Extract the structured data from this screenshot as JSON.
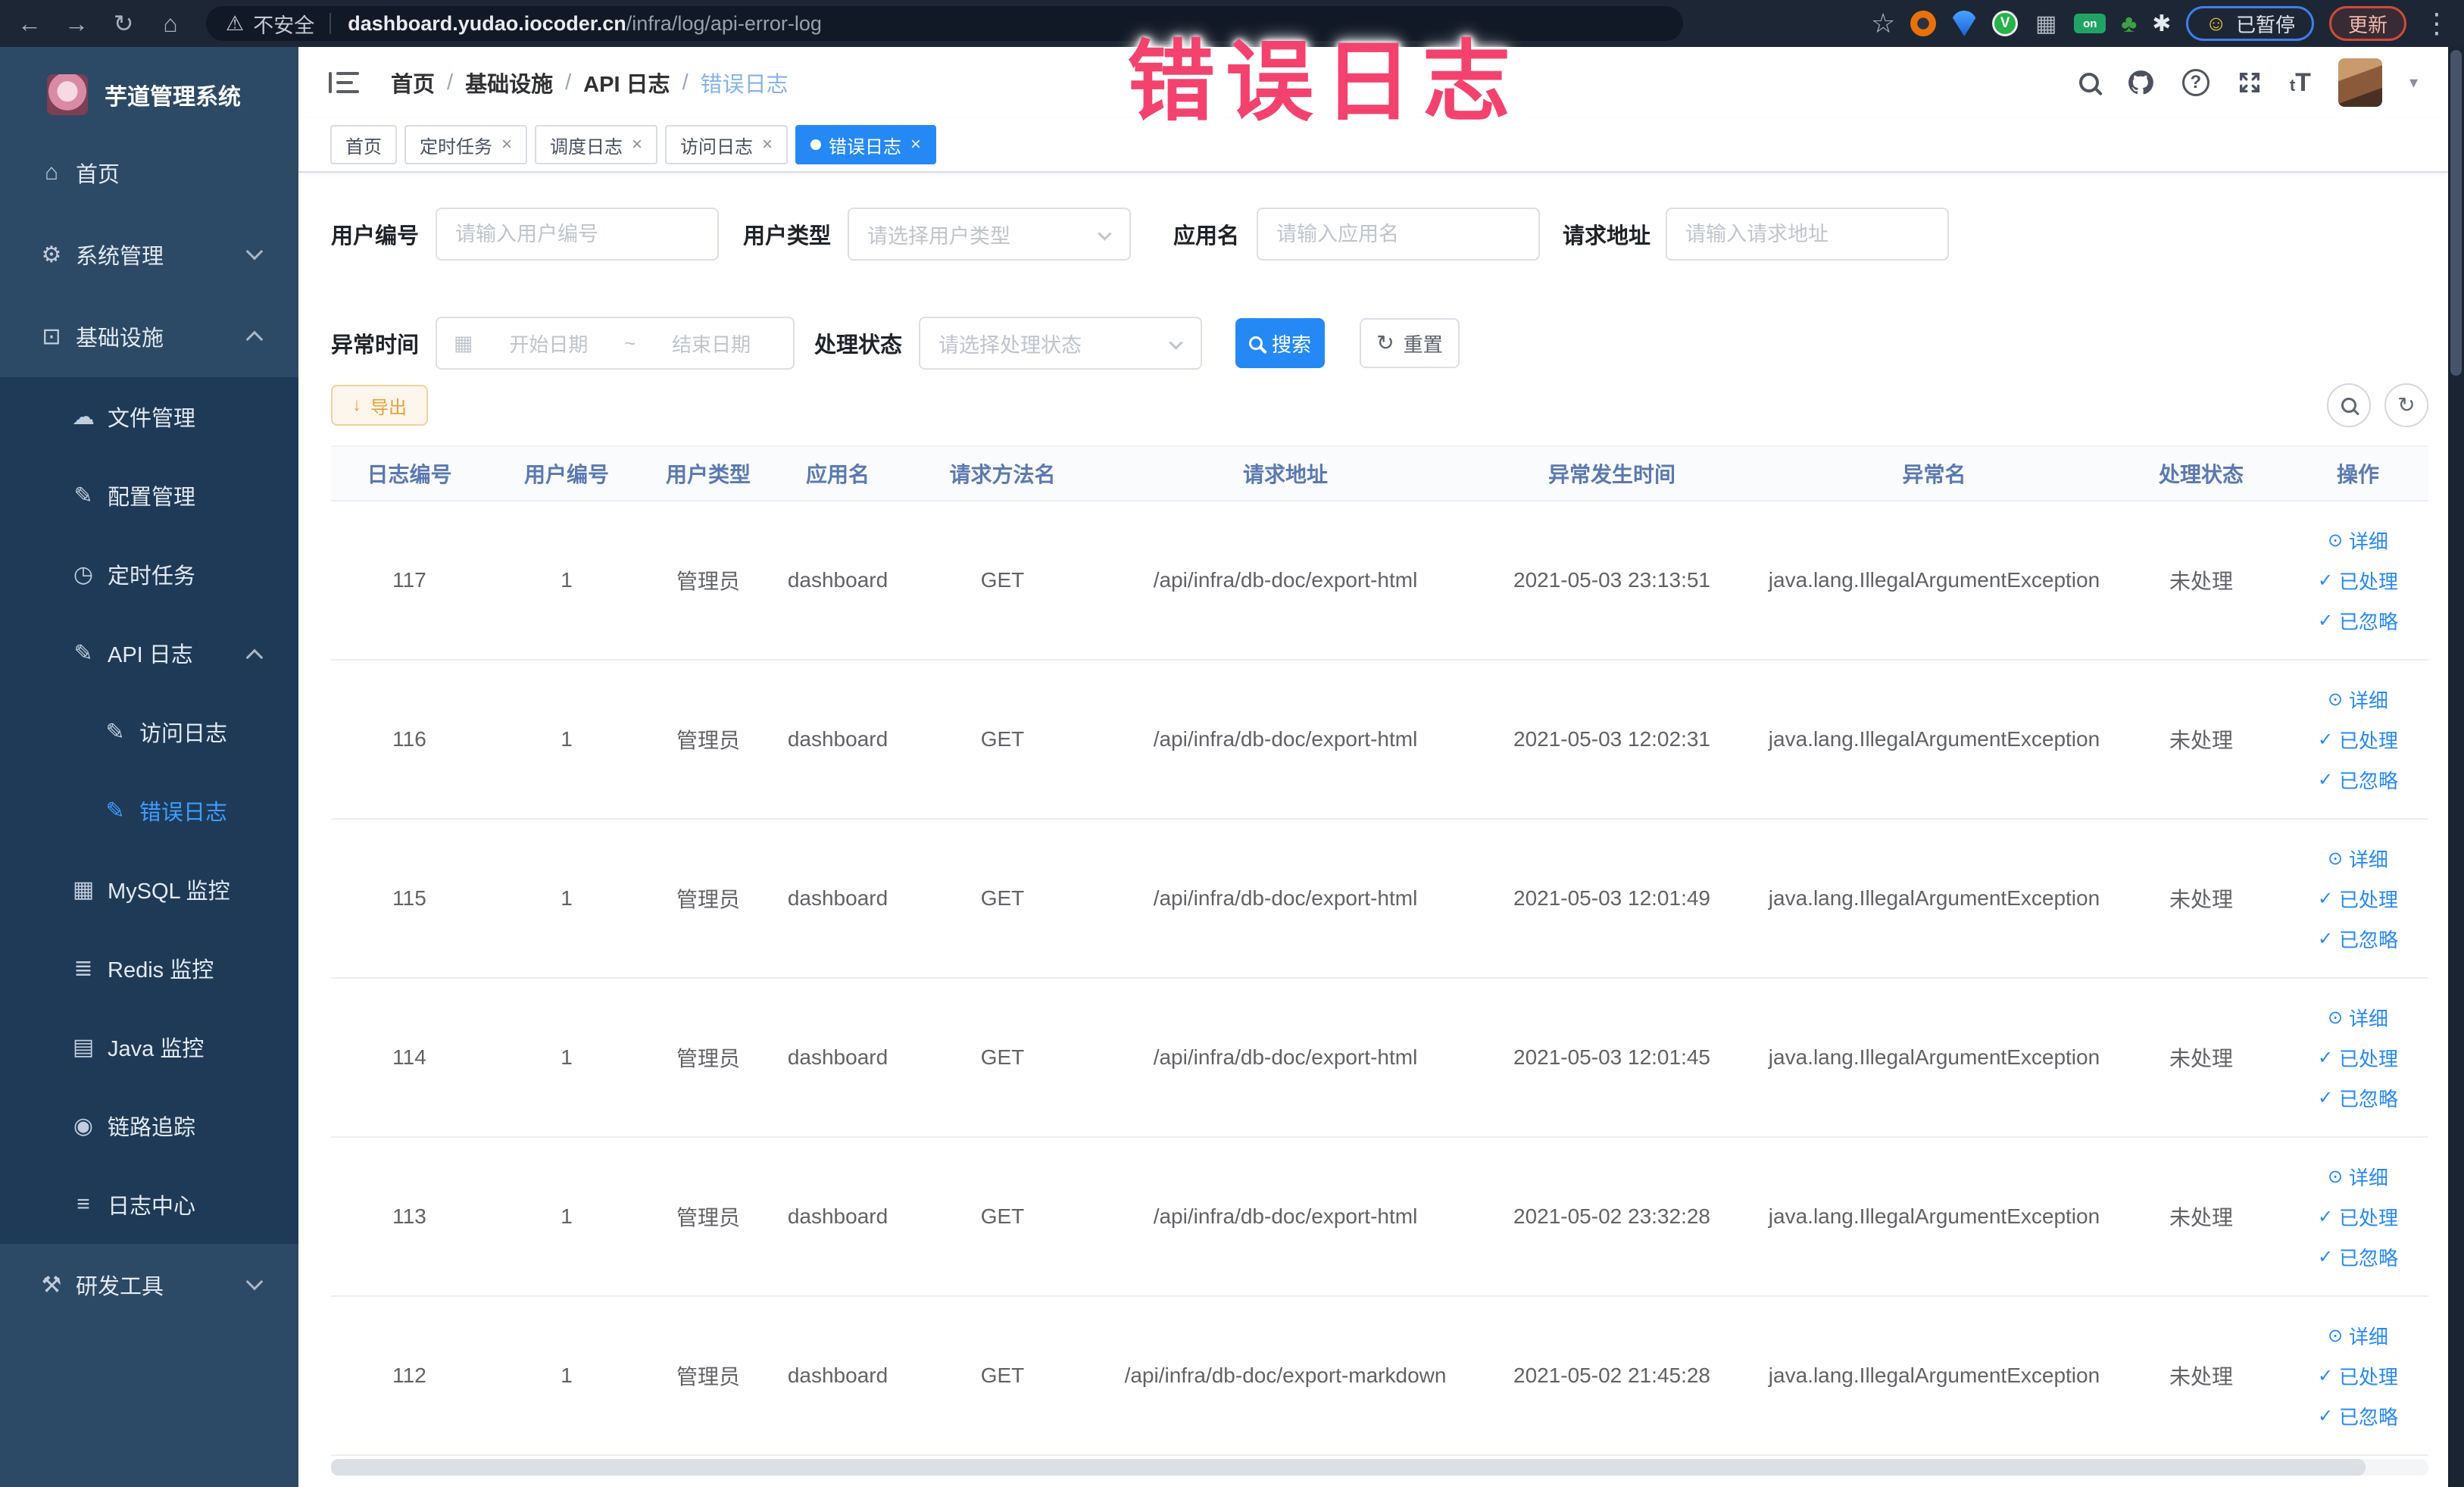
{
  "colors": {
    "primary": "#2589f5",
    "warning": "#e6a23c",
    "overlay_pink": "#f4426e",
    "sidebar_bg": "#2c4965",
    "submenu_bg": "#1e3a57"
  },
  "browser": {
    "security_label": "不安全",
    "url_host": "dashboard.yudao.iocoder.cn",
    "url_path": "/infra/log/api-error-log",
    "paused_label": "已暂停",
    "update_label": "更新"
  },
  "overlay_title": "错误日志",
  "sidebar": {
    "title": "芋道管理系统",
    "items": [
      {
        "key": "home",
        "label": "首页",
        "icon": "home",
        "level": 1,
        "group": false
      },
      {
        "key": "system-management",
        "label": "系统管理",
        "icon": "gear",
        "level": 1,
        "group": false,
        "chevron": "down"
      },
      {
        "key": "infrastructure",
        "label": "基础设施",
        "icon": "monitor",
        "level": 1,
        "group": false,
        "chevron": "up"
      },
      {
        "key": "file-management",
        "label": "文件管理",
        "icon": "cloud",
        "level": 2,
        "group": true
      },
      {
        "key": "config-management",
        "label": "配置管理",
        "icon": "edit",
        "level": 2,
        "group": true
      },
      {
        "key": "scheduled-tasks",
        "label": "定时任务",
        "icon": "timer",
        "level": 2,
        "group": true
      },
      {
        "key": "api-log",
        "label": "API 日志",
        "icon": "edit",
        "level": 2,
        "group": true,
        "chevron": "up"
      },
      {
        "key": "access-log",
        "label": "访问日志",
        "icon": "edit",
        "level": 3,
        "group": true
      },
      {
        "key": "error-log",
        "label": "错误日志",
        "icon": "edit",
        "level": 3,
        "group": true,
        "active": true
      },
      {
        "key": "mysql-monitor",
        "label": "MySQL 监控",
        "icon": "mysql",
        "level": 2,
        "group": true
      },
      {
        "key": "redis-monitor",
        "label": "Redis 监控",
        "icon": "redis",
        "level": 2,
        "group": true
      },
      {
        "key": "java-monitor",
        "label": "Java 监控",
        "icon": "java",
        "level": 2,
        "group": true
      },
      {
        "key": "trace",
        "label": "链路追踪",
        "icon": "eye",
        "level": 2,
        "group": true
      },
      {
        "key": "log-center",
        "label": "日志中心",
        "icon": "list",
        "level": 2,
        "group": true
      },
      {
        "key": "dev-tools",
        "label": "研发工具",
        "icon": "tools",
        "level": 1,
        "group": false,
        "chevron": "down"
      }
    ]
  },
  "header": {
    "breadcrumb": [
      "首页",
      "基础设施",
      "API 日志",
      "错误日志"
    ]
  },
  "tabs": [
    {
      "key": "home",
      "label": "首页",
      "closable": false,
      "active": false
    },
    {
      "key": "scheduled-tasks",
      "label": "定时任务",
      "closable": true,
      "active": false
    },
    {
      "key": "schedule-log",
      "label": "调度日志",
      "closable": true,
      "active": false
    },
    {
      "key": "access-log",
      "label": "访问日志",
      "closable": true,
      "active": false
    },
    {
      "key": "error-log",
      "label": "错误日志",
      "closable": true,
      "active": true
    }
  ],
  "filters": {
    "user_id": {
      "label": "用户编号",
      "placeholder": "请输入用户编号"
    },
    "user_type": {
      "label": "用户类型",
      "placeholder": "请选择用户类型"
    },
    "app_name": {
      "label": "应用名",
      "placeholder": "请输入应用名"
    },
    "request_url": {
      "label": "请求地址",
      "placeholder": "请输入请求地址"
    },
    "exception_time": {
      "label": "异常时间",
      "start_placeholder": "开始日期",
      "separator": "~",
      "end_placeholder": "结束日期"
    },
    "process_status": {
      "label": "处理状态",
      "placeholder": "请选择处理状态"
    },
    "search_label": "搜索",
    "reset_label": "重置"
  },
  "toolbar": {
    "export_label": "导出"
  },
  "table": {
    "columns": [
      "日志编号",
      "用户编号",
      "用户类型",
      "应用名",
      "请求方法名",
      "请求地址",
      "异常发生时间",
      "异常名",
      "处理状态",
      "操作"
    ],
    "actions": [
      {
        "icon": "eye",
        "label": "详细"
      },
      {
        "icon": "check",
        "label": "已处理"
      },
      {
        "icon": "check",
        "label": "已忽略"
      }
    ],
    "rows": [
      {
        "log_id": "117",
        "user_id": "1",
        "user_type": "管理员",
        "app_name": "dashboard",
        "method": "GET",
        "url": "/api/infra/db-doc/export-html",
        "time": "2021-05-03 23:13:51",
        "exception": "java.lang.IllegalArgumentException",
        "status": "未处理"
      },
      {
        "log_id": "116",
        "user_id": "1",
        "user_type": "管理员",
        "app_name": "dashboard",
        "method": "GET",
        "url": "/api/infra/db-doc/export-html",
        "time": "2021-05-03 12:02:31",
        "exception": "java.lang.IllegalArgumentException",
        "status": "未处理"
      },
      {
        "log_id": "115",
        "user_id": "1",
        "user_type": "管理员",
        "app_name": "dashboard",
        "method": "GET",
        "url": "/api/infra/db-doc/export-html",
        "time": "2021-05-03 12:01:49",
        "exception": "java.lang.IllegalArgumentException",
        "status": "未处理"
      },
      {
        "log_id": "114",
        "user_id": "1",
        "user_type": "管理员",
        "app_name": "dashboard",
        "method": "GET",
        "url": "/api/infra/db-doc/export-html",
        "time": "2021-05-03 12:01:45",
        "exception": "java.lang.IllegalArgumentException",
        "status": "未处理"
      },
      {
        "log_id": "113",
        "user_id": "1",
        "user_type": "管理员",
        "app_name": "dashboard",
        "method": "GET",
        "url": "/api/infra/db-doc/export-html",
        "time": "2021-05-02 23:32:28",
        "exception": "java.lang.IllegalArgumentException",
        "status": "未处理"
      },
      {
        "log_id": "112",
        "user_id": "1",
        "user_type": "管理员",
        "app_name": "dashboard",
        "method": "GET",
        "url": "/api/infra/db-doc/export-markdown",
        "time": "2021-05-02 21:45:28",
        "exception": "java.lang.IllegalArgumentException",
        "status": "未处理"
      }
    ]
  }
}
